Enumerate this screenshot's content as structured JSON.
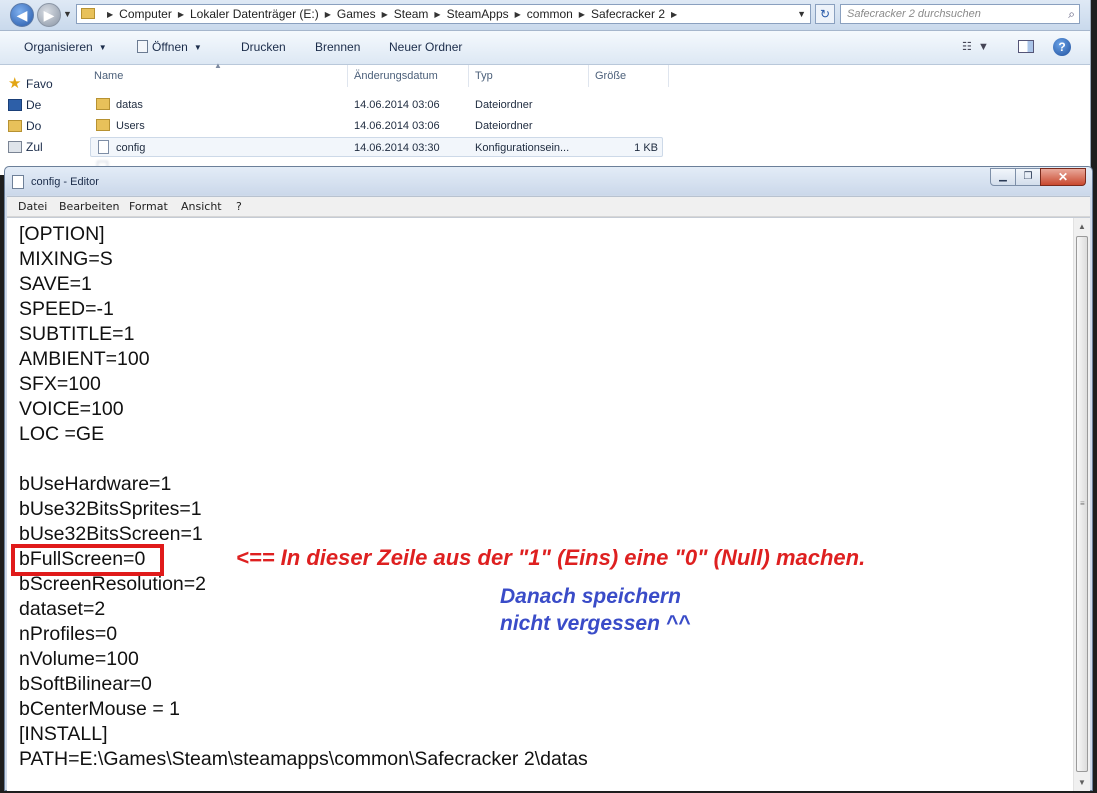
{
  "explorer": {
    "address_crumbs": [
      "Computer",
      "Lokaler Datenträger (E:)",
      "Games",
      "Steam",
      "SteamApps",
      "common",
      "Safecracker 2"
    ],
    "search_placeholder": "Safecracker 2 durchsuchen",
    "toolbar": {
      "organize": "Organisieren",
      "open": "Öffnen",
      "print": "Drucken",
      "burn": "Brennen",
      "new_folder": "Neuer Ordner"
    },
    "nav_items": [
      "Favo",
      "De",
      "Do",
      "Zul"
    ],
    "columns": {
      "name": "Name",
      "date": "Änderungsdatum",
      "type": "Typ",
      "size": "Größe"
    },
    "files": [
      {
        "name": "datas",
        "date": "14.06.2014 03:06",
        "type": "Dateiordner",
        "size": "",
        "icon": "folder-icon"
      },
      {
        "name": "Users",
        "date": "14.06.2014 03:06",
        "type": "Dateiordner",
        "size": "",
        "icon": "folder-icon"
      },
      {
        "name": "config",
        "date": "14.06.2014 03:30",
        "type": "Konfigurationsein...",
        "size": "1 KB",
        "icon": "config-file-icon"
      }
    ]
  },
  "notepad": {
    "title": "config - Editor",
    "menu": [
      "Datei",
      "Bearbeiten",
      "Format",
      "Ansicht",
      "?"
    ],
    "lines": [
      "[OPTION]",
      "MIXING=S",
      "SAVE=1",
      "SPEED=-1",
      "SUBTITLE=1",
      "AMBIENT=100",
      "SFX=100",
      "VOICE=100",
      "LOC =GE",
      "",
      "bUseHardware=1",
      "bUse32BitsSprites=1",
      "bUse32BitsScreen=1",
      "bFullScreen=0",
      "bScreenResolution=2",
      "dataset=2",
      "nProfiles=0",
      "nVolume=100",
      "bSoftBilinear=0",
      "bCenterMouse = 1",
      "[INSTALL]",
      "PATH=E:\\Games\\Steam\\steamapps\\common\\Safecracker 2\\datas"
    ]
  },
  "annotation": {
    "instruction": "<== In dieser Zeile aus der \"1\" (Eins) eine \"0\" (Null) machen.",
    "save_line1": "Danach speichern",
    "save_line2": "nicht vergessen ^^",
    "highlight_color": "#e01a1a",
    "instruction_color": "#de2020",
    "save_color": "#3a4cc8"
  }
}
